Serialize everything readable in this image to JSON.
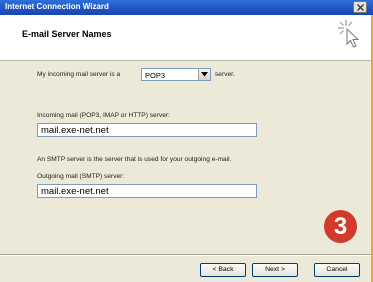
{
  "window": {
    "title": "Internet Connection Wizard"
  },
  "header": {
    "title": "E-mail Server Names",
    "icon": "wizard-wand-icon"
  },
  "incoming_type": {
    "label_prefix": "My incoming mail server is a",
    "selected": "POP3",
    "label_suffix": "server."
  },
  "incoming_server": {
    "label": "Incoming mail (POP3, IMAP or HTTP) server:",
    "value": "mail.exe-net.net"
  },
  "smtp_info": "An SMTP server is the server that is used for your outgoing e-mail.",
  "outgoing_server": {
    "label": "Outgoing mail (SMTP) server:",
    "value": "mail.exe-net.net"
  },
  "buttons": {
    "back": "< Back",
    "next": "Next >",
    "cancel": "Cancel"
  },
  "step_badge": "3",
  "colors": {
    "titlebar": "#1f55c4",
    "dialog_bg": "#ece9d8",
    "frame": "#e9a53a",
    "badge": "#d23b2c"
  }
}
